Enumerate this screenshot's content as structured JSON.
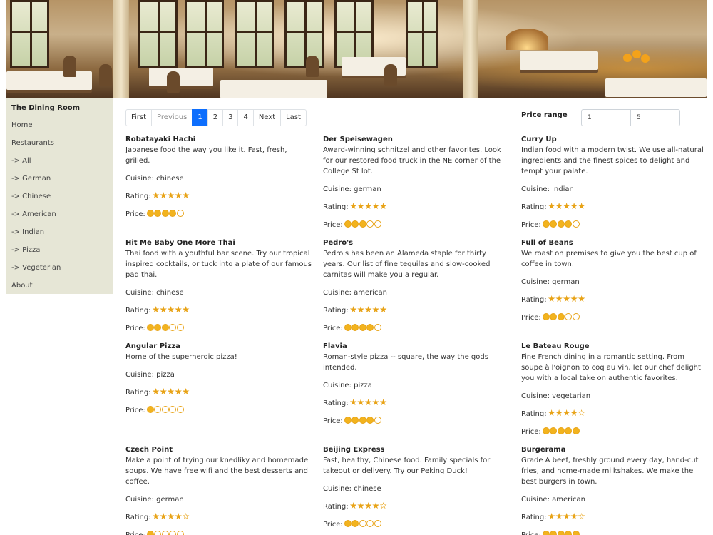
{
  "app": {
    "name": "The Dining Room"
  },
  "colors": {
    "accent": "#0d6efd",
    "star": "#e8a317",
    "sidebar_bg": "#e6e6d6"
  },
  "sidebar": {
    "items": [
      {
        "label": "Home"
      },
      {
        "label": "Restaurants"
      },
      {
        "label": "-> All"
      },
      {
        "label": "-> German"
      },
      {
        "label": "-> Chinese"
      },
      {
        "label": "-> American"
      },
      {
        "label": "-> Indian"
      },
      {
        "label": "-> Pizza"
      },
      {
        "label": "-> Vegeterian"
      },
      {
        "label": "About"
      }
    ]
  },
  "pagination": {
    "items": [
      {
        "label": "First",
        "state": "normal"
      },
      {
        "label": "Previous",
        "state": "disabled"
      },
      {
        "label": "1",
        "state": "active"
      },
      {
        "label": "2",
        "state": "normal"
      },
      {
        "label": "3",
        "state": "normal"
      },
      {
        "label": "4",
        "state": "normal"
      },
      {
        "label": "Next",
        "state": "normal"
      },
      {
        "label": "Last",
        "state": "normal"
      }
    ]
  },
  "price_range": {
    "label": "Price range",
    "min": "1",
    "max": "5"
  },
  "labels": {
    "cuisine": "Cuisine: ",
    "rating": "Rating:",
    "price": "Price:"
  },
  "restaurants": [
    {
      "name": "Robatayaki Hachi",
      "description": "Japanese food the way you like it. Fast, fresh, grilled.",
      "cuisine": "chinese",
      "rating": 5,
      "price": 4
    },
    {
      "name": "Der Speisewagen",
      "description": "Award-winning schnitzel and other favorites. Look for our restored food truck in the NE corner of the College St lot.",
      "cuisine": "german",
      "rating": 5,
      "price": 3
    },
    {
      "name": "Curry Up",
      "description": "Indian food with a modern twist. We use all-natural ingredients and the finest spices to delight and tempt your palate.",
      "cuisine": "indian",
      "rating": 5,
      "price": 4
    },
    {
      "name": "Hit Me Baby One More Thai",
      "description": "Thai food with a youthful bar scene. Try our tropical inspired cocktails, or tuck into a plate of our famous pad thai.",
      "cuisine": "chinese",
      "rating": 5,
      "price": 3
    },
    {
      "name": "Pedro's",
      "description": "Pedro's has been an Alameda staple for thirty years. Our list of fine tequilas and slow-cooked carnitas will make you a regular.",
      "cuisine": "american",
      "rating": 5,
      "price": 4
    },
    {
      "name": "Full of Beans",
      "description": "We roast on premises to give you the best cup of coffee in town.",
      "cuisine": "german",
      "rating": 5,
      "price": 3
    },
    {
      "name": "Angular Pizza",
      "description": "Home of the superheroic pizza!",
      "cuisine": "pizza",
      "rating": 5,
      "price": 1
    },
    {
      "name": "Flavia",
      "description": "Roman-style pizza -- square, the way the gods intended.",
      "cuisine": "pizza",
      "rating": 5,
      "price": 4
    },
    {
      "name": "Le Bateau Rouge",
      "description": "Fine French dining in a romantic setting. From soupe à l'oignon to coq au vin, let our chef delight you with a local take on authentic favorites.",
      "cuisine": "vegetarian",
      "rating": 4,
      "price": 5
    },
    {
      "name": "Czech Point",
      "description": "Make a point of trying our knedlíky and homemade soups. We have free wifi and the best desserts and coffee.",
      "cuisine": "german",
      "rating": 4,
      "price": 1
    },
    {
      "name": "Beijing Express",
      "description": "Fast, healthy, Chinese food. Family specials for takeout or delivery. Try our Peking Duck!",
      "cuisine": "chinese",
      "rating": 4,
      "price": 2
    },
    {
      "name": "Burgerama",
      "description": "Grade A beef, freshly ground every day, hand-cut fries, and home-made milkshakes. We make the best burgers in town.",
      "cuisine": "american",
      "rating": 4,
      "price": 5
    }
  ]
}
